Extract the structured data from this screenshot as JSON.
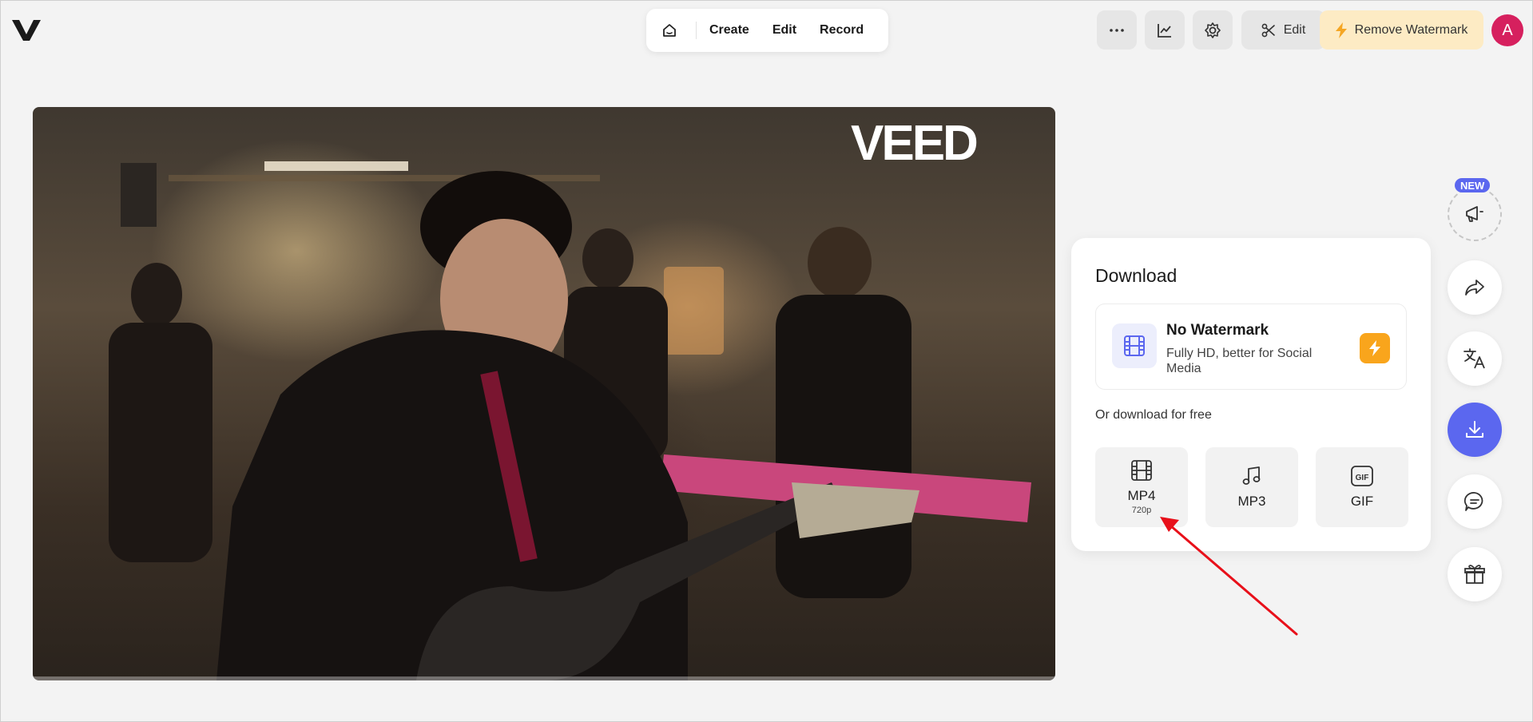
{
  "nav": {
    "items": [
      "Create",
      "Edit",
      "Record"
    ]
  },
  "toolbar": {
    "edit_label": "Edit",
    "remove_watermark_label": "Remove Watermark"
  },
  "user": {
    "avatar_initial": "A"
  },
  "video": {
    "watermark_text": "VEED"
  },
  "download": {
    "title": "Download",
    "no_watermark": {
      "title": "No Watermark",
      "subtitle": "Fully HD, better for Social Media"
    },
    "free_label": "Or download for free",
    "formats": [
      {
        "label": "MP4",
        "sub": "720p"
      },
      {
        "label": "MP3",
        "sub": ""
      },
      {
        "label": "GIF",
        "sub": ""
      }
    ]
  },
  "rail": {
    "new_badge": "NEW"
  },
  "colors": {
    "accent": "#5b67ef",
    "watermark_btn_bg": "#fdebc4",
    "bolt": "#f9a51c",
    "avatar": "#d6205e",
    "arrow": "#e8101a"
  }
}
